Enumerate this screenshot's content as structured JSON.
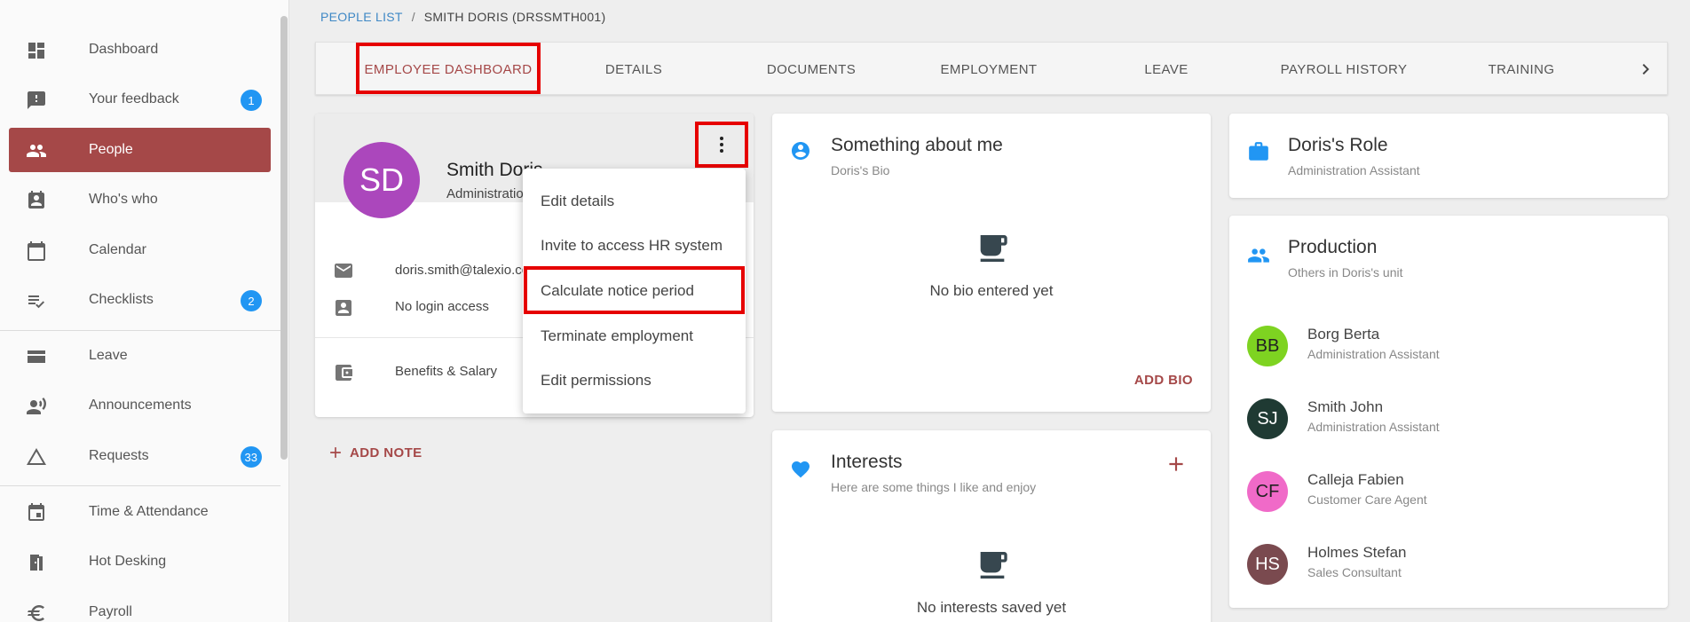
{
  "sidebar": {
    "items": [
      {
        "label": "Dashboard",
        "icon": "dashboard-icon"
      },
      {
        "label": "Your feedback",
        "icon": "feedback-icon",
        "badge": "1"
      },
      {
        "label": "People",
        "icon": "people-icon",
        "active": true
      },
      {
        "label": "Who's who",
        "icon": "badge-icon"
      },
      {
        "label": "Calendar",
        "icon": "calendar-icon"
      },
      {
        "label": "Checklists",
        "icon": "checklist-icon",
        "badge": "2"
      },
      {
        "label": "Leave",
        "icon": "leave-icon"
      },
      {
        "label": "Announcements",
        "icon": "announcement-icon"
      },
      {
        "label": "Requests",
        "icon": "triangle-icon",
        "badge": "33"
      },
      {
        "label": "Time & Attendance",
        "icon": "time-calendar-icon"
      },
      {
        "label": "Hot Desking",
        "icon": "door-icon"
      },
      {
        "label": "Payroll",
        "icon": "euro-icon"
      }
    ]
  },
  "breadcrumb": {
    "link": "PEOPLE LIST",
    "separator": "/",
    "current": "SMITH DORIS (DRSSMTH001)"
  },
  "tabs": [
    "EMPLOYEE DASHBOARD",
    "DETAILS",
    "DOCUMENTS",
    "EMPLOYMENT",
    "LEAVE",
    "PAYROLL HISTORY",
    "TRAINING"
  ],
  "profile": {
    "initials": "SD",
    "name": "Smith Doris",
    "role": "Administration Assistant",
    "email": "doris.smith@talexio.com",
    "login": "No login access",
    "benefits": "Benefits & Salary"
  },
  "menu": {
    "items": [
      "Edit details",
      "Invite to access HR system",
      "Calculate notice period",
      "Terminate employment",
      "Edit permissions"
    ]
  },
  "add_note": "ADD NOTE",
  "about": {
    "title": "Something about me",
    "subtitle": "Doris's Bio",
    "empty": "No bio entered yet",
    "action": "ADD BIO"
  },
  "interests": {
    "title": "Interests",
    "subtitle": "Here are some things I like and enjoy",
    "empty": "No interests saved yet"
  },
  "role_card": {
    "title": "Doris's Role",
    "subtitle": "Administration Assistant"
  },
  "unit": {
    "title": "Production",
    "subtitle": "Others in Doris's unit",
    "people": [
      {
        "initials": "BB",
        "name": "Borg Berta",
        "role": "Administration Assistant",
        "color": "#7ed321",
        "text_color": "#222222"
      },
      {
        "initials": "SJ",
        "name": "Smith John",
        "role": "Administration Assistant",
        "color": "#1f3a33",
        "text_color": "#ffffff"
      },
      {
        "initials": "CF",
        "name": "Calleja Fabien",
        "role": "Customer Care Agent",
        "color": "#f06ac8",
        "text_color": "#222222"
      },
      {
        "initials": "HS",
        "name": "Holmes Stefan",
        "role": "Sales Consultant",
        "color": "#7a4a4f",
        "text_color": "#ffffff"
      }
    ]
  },
  "colors": {
    "accent": "#a54848",
    "highlight": "#e60000",
    "badge": "#2196f3"
  }
}
